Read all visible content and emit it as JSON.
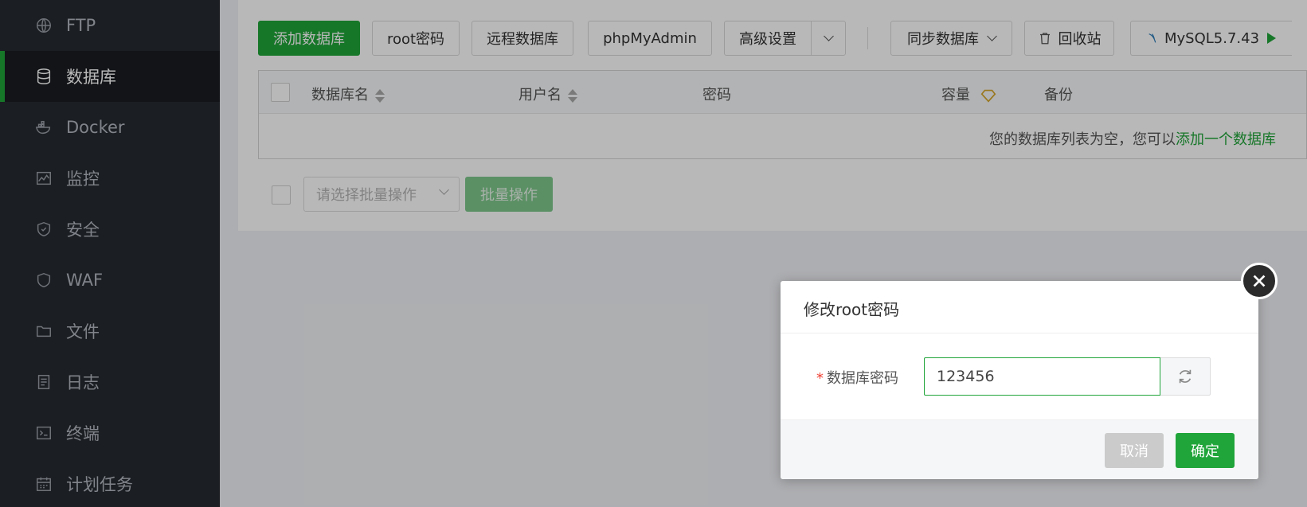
{
  "sidebar": {
    "items": [
      {
        "label": "FTP",
        "icon": "globe-icon"
      },
      {
        "label": "数据库",
        "icon": "database-icon",
        "active": true
      },
      {
        "label": "Docker",
        "icon": "docker-icon"
      },
      {
        "label": "监控",
        "icon": "monitor-chart-icon"
      },
      {
        "label": "安全",
        "icon": "shield-icon"
      },
      {
        "label": "WAF",
        "icon": "waf-shield-icon"
      },
      {
        "label": "文件",
        "icon": "folder-icon"
      },
      {
        "label": "日志",
        "icon": "log-file-icon"
      },
      {
        "label": "终端",
        "icon": "terminal-icon"
      },
      {
        "label": "计划任务",
        "icon": "calendar-icon"
      }
    ]
  },
  "toolbar": {
    "add_db": "添加数据库",
    "root_pwd": "root密码",
    "remote_db": "远程数据库",
    "phpmyadmin": "phpMyAdmin",
    "advanced": "高级设置",
    "sync_db": "同步数据库",
    "recycle": "回收站",
    "mysql_version": "MySQL5.7.43"
  },
  "table": {
    "headers": {
      "name": "数据库名",
      "user": "用户名",
      "password": "密码",
      "size": "容量",
      "backup": "备份"
    },
    "empty_text": "您的数据库列表为空，您可以",
    "empty_link": "添加一个数据库"
  },
  "batch": {
    "placeholder": "请选择批量操作",
    "button": "批量操作"
  },
  "dialog": {
    "title": "修改root密码",
    "field_label": "数据库密码",
    "required_mark": "*",
    "password_value": "123456",
    "cancel": "取消",
    "confirm": "确定"
  },
  "colors": {
    "accent": "#20a53a",
    "sidebar_bg": "#262a30"
  }
}
